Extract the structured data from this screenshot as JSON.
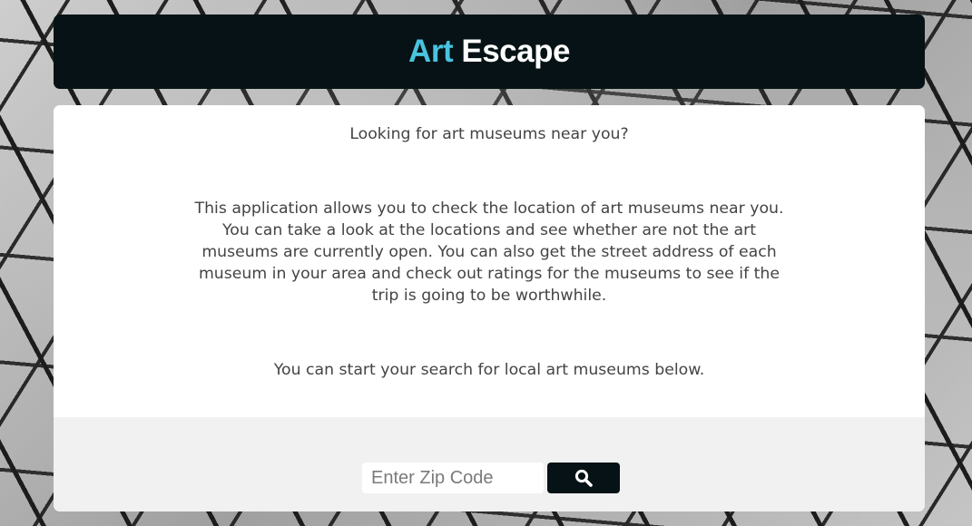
{
  "header": {
    "title_accent": "Art",
    "title_main": "Escape"
  },
  "content": {
    "intro": "Looking for art museums near you?",
    "description": "This application allows you to check the location of art museums near you. You can take a look at the locations and see whether are not the art museums are currently open. You can also get the street address of each museum in your area and check out ratings for the museums to see if the trip is going to be worthwhile.",
    "cta": "You can start your search for local art museums below."
  },
  "search": {
    "placeholder": "Enter Zip Code",
    "value": "",
    "button_icon": "search-icon"
  },
  "colors": {
    "accent": "#49c3df",
    "header_bg": "#061215",
    "footer_bg": "#f1f1f1"
  }
}
